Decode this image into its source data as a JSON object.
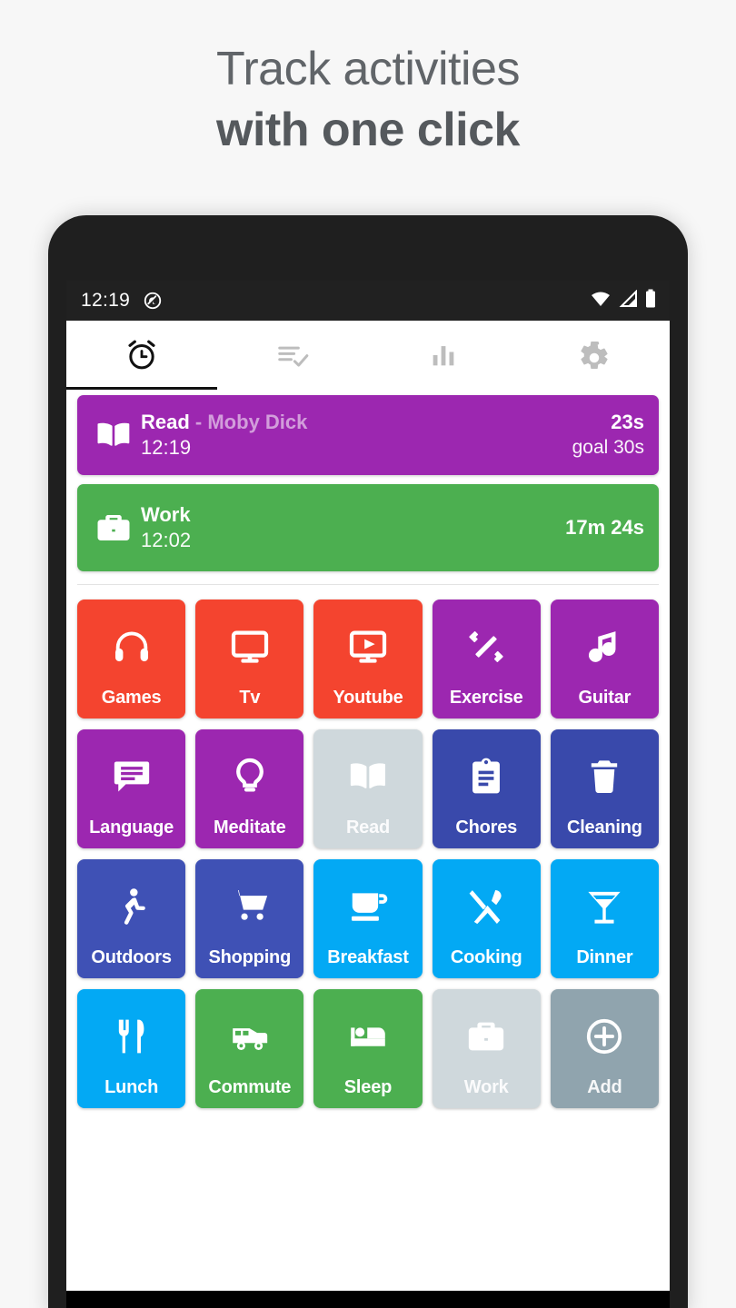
{
  "headline": {
    "line1": "Track activities",
    "line2": "with one click"
  },
  "statusbar": {
    "time": "12:19",
    "icons": [
      "do-not-disturb-icon",
      "wifi-icon",
      "signal-icon",
      "battery-icon"
    ]
  },
  "tabs": [
    {
      "name": "timers",
      "icon": "alarm-clock-icon",
      "active": true
    },
    {
      "name": "history",
      "icon": "playlist-check-icon",
      "active": false
    },
    {
      "name": "statistics",
      "icon": "bar-chart-icon",
      "active": false
    },
    {
      "name": "settings",
      "icon": "gear-icon",
      "active": false
    }
  ],
  "running": [
    {
      "title": "Read",
      "subtitle": "- Moby Dick",
      "start_time": "12:19",
      "elapsed": "23s",
      "goal": "goal 30s",
      "icon": "book-icon",
      "color": "#9C27B0"
    },
    {
      "title": "Work",
      "subtitle": "",
      "start_time": "12:02",
      "elapsed": "17m 24s",
      "goal": "",
      "icon": "briefcase-icon",
      "color": "#4CAF50"
    }
  ],
  "activities": [
    {
      "label": "Games",
      "icon": "headphones-icon",
      "color": "#F4442F",
      "state": "idle"
    },
    {
      "label": "Tv",
      "icon": "monitor-icon",
      "color": "#F4442F",
      "state": "idle"
    },
    {
      "label": "Youtube",
      "icon": "play-box-icon",
      "color": "#F4442F",
      "state": "idle"
    },
    {
      "label": "Exercise",
      "icon": "dumbbell-icon",
      "color": "#9C27B0",
      "state": "idle"
    },
    {
      "label": "Guitar",
      "icon": "music-note-icon",
      "color": "#9C27B0",
      "state": "idle"
    },
    {
      "label": "Language",
      "icon": "chat-lines-icon",
      "color": "#9C27B0",
      "state": "idle"
    },
    {
      "label": "Meditate",
      "icon": "lightbulb-icon",
      "color": "#9C27B0",
      "state": "idle"
    },
    {
      "label": "Read",
      "icon": "book-icon",
      "color": "#CFD8DC",
      "state": "running"
    },
    {
      "label": "Chores",
      "icon": "clipboard-icon",
      "color": "#3949AB",
      "state": "idle"
    },
    {
      "label": "Cleaning",
      "icon": "trash-icon",
      "color": "#3949AB",
      "state": "idle"
    },
    {
      "label": "Outdoors",
      "icon": "walk-icon",
      "color": "#3F51B5",
      "state": "idle"
    },
    {
      "label": "Shopping",
      "icon": "cart-icon",
      "color": "#3F51B5",
      "state": "idle"
    },
    {
      "label": "Breakfast",
      "icon": "coffee-cup-icon",
      "color": "#03A9F4",
      "state": "idle"
    },
    {
      "label": "Cooking",
      "icon": "fork-spoon-icon",
      "color": "#03A9F4",
      "state": "idle"
    },
    {
      "label": "Dinner",
      "icon": "cocktail-icon",
      "color": "#03A9F4",
      "state": "idle"
    },
    {
      "label": "Lunch",
      "icon": "fork-knife-icon",
      "color": "#03A9F4",
      "state": "idle"
    },
    {
      "label": "Commute",
      "icon": "van-icon",
      "color": "#4CAF50",
      "state": "idle"
    },
    {
      "label": "Sleep",
      "icon": "bed-icon",
      "color": "#4CAF50",
      "state": "idle"
    },
    {
      "label": "Work",
      "icon": "briefcase-icon",
      "color": "#CFD8DC",
      "state": "running"
    },
    {
      "label": "Add",
      "icon": "plus-circle-icon",
      "color": "#90A4AE",
      "state": "action"
    }
  ],
  "colors": {
    "background": "#f7f7f7",
    "headline_text": "#5b5f63",
    "phone_frame": "#1f1f1f",
    "status_bar": "#212121",
    "screen": "#ffffff",
    "tab_active_indicator": "#111111",
    "divider": "#e3e3e3"
  }
}
